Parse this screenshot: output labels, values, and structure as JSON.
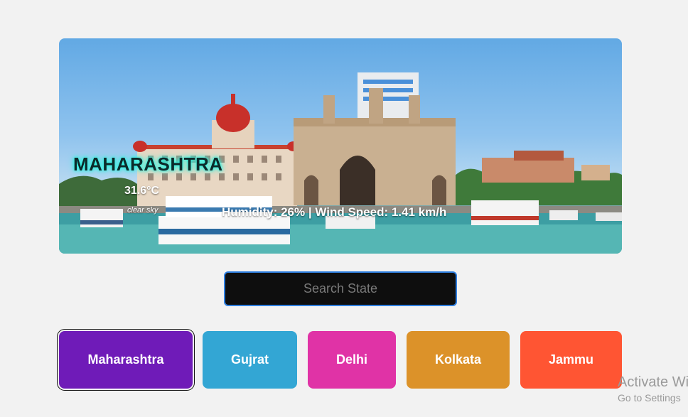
{
  "weather": {
    "state_name": "MAHARASHTRA",
    "temperature": "31.6°C",
    "description": "clear sky",
    "details": "Humidity: 26% | Wind Speed: 1.41 km/h"
  },
  "search": {
    "placeholder": "Search State",
    "value": ""
  },
  "states": [
    {
      "label": "Maharashtra",
      "color": "#6f1bb8",
      "active": true
    },
    {
      "label": "Gujrat",
      "color": "#33a6d4",
      "active": false
    },
    {
      "label": "Delhi",
      "color": "#e033a6",
      "active": false
    },
    {
      "label": "Kolkata",
      "color": "#dc9229",
      "active": false
    },
    {
      "label": "Jammu",
      "color": "#ff5533",
      "active": false
    }
  ],
  "watermark": {
    "line1": "Activate Wi",
    "line2": "Go to Settings"
  }
}
